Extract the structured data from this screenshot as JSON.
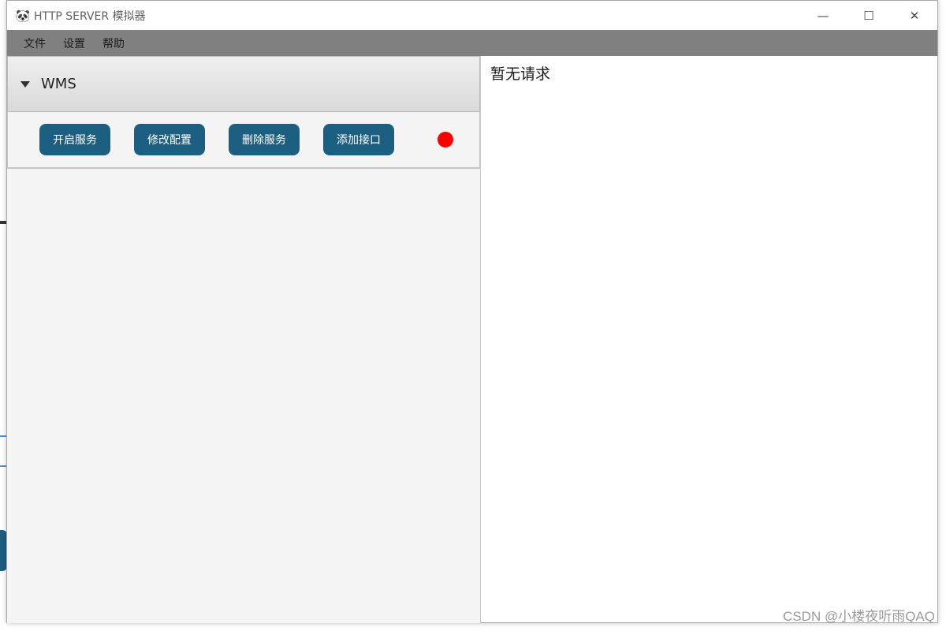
{
  "window": {
    "title": "HTTP SERVER 模拟器",
    "app_icon": "panda-icon",
    "controls": {
      "minimize": "—",
      "maximize": "☐",
      "close": "✕"
    }
  },
  "menu": {
    "items": [
      {
        "label": "文件"
      },
      {
        "label": "设置"
      },
      {
        "label": "帮助"
      }
    ]
  },
  "service_panel": {
    "title": "WMS",
    "expanded": true,
    "buttons": {
      "start": "开启服务",
      "edit_config": "修改配置",
      "delete": "删除服务",
      "add_interface": "添加接口"
    },
    "status_color": "#ff0000"
  },
  "requests": {
    "empty_text": "暂无请求"
  },
  "watermark": "CSDN @小楼夜听雨QAQ",
  "colors": {
    "menubar": "#808080",
    "button": "#1d5f80",
    "status_stopped": "#ff0000"
  }
}
